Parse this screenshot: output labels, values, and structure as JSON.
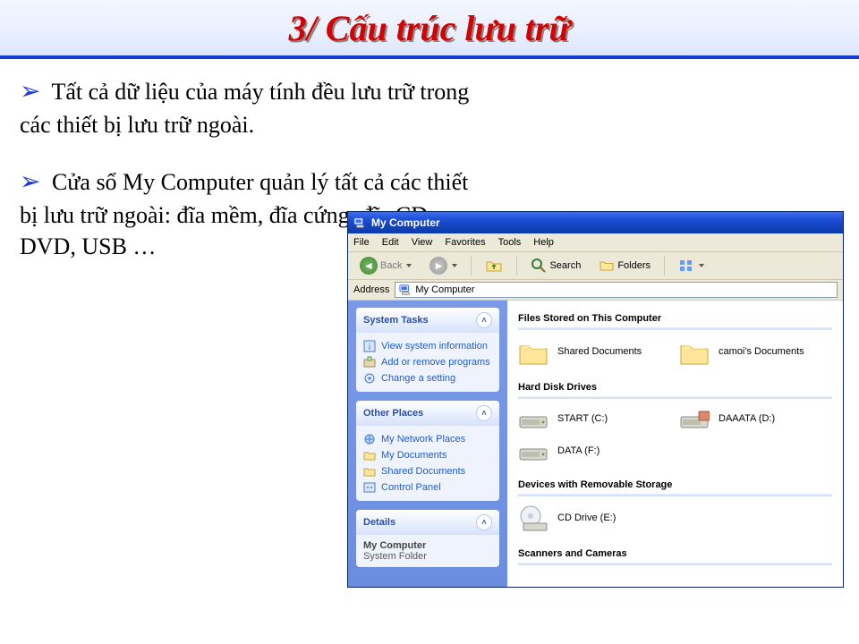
{
  "slide": {
    "title": "3/ Cấu trúc lưu trữ",
    "p1": "Tất cả dữ liệu của máy tính đều lưu trữ trong các thiết bị lưu trữ ngoài.",
    "p2": "Cửa sổ My Computer quản lý tất cả các thiết bị lưu trữ ngoài: đĩa mềm, đĩa cứng, đĩa CD, DVD, USB …"
  },
  "window": {
    "title": "My Computer",
    "menu": [
      "File",
      "Edit",
      "View",
      "Favorites",
      "Tools",
      "Help"
    ],
    "toolbar": {
      "back": "Back",
      "search": "Search",
      "folders": "Folders"
    },
    "address_label": "Address",
    "address_value": "My Computer",
    "sidebar": {
      "system_tasks": {
        "title": "System Tasks",
        "items": [
          "View system information",
          "Add or remove programs",
          "Change a setting"
        ]
      },
      "other_places": {
        "title": "Other Places",
        "items": [
          "My Network Places",
          "My Documents",
          "Shared Documents",
          "Control Panel"
        ]
      },
      "details": {
        "title": "Details",
        "name": "My Computer",
        "type": "System Folder"
      }
    },
    "main": {
      "sections": {
        "files": {
          "title": "Files Stored on This Computer",
          "items": [
            "Shared Documents",
            "camoi's Documents"
          ]
        },
        "hdd": {
          "title": "Hard Disk Drives",
          "items": [
            "START (C:)",
            "DAAATA (D:)",
            "DATA (F:)"
          ]
        },
        "removable": {
          "title": "Devices with Removable Storage",
          "items": [
            "CD Drive (E:)"
          ]
        },
        "scanners": {
          "title": "Scanners and Cameras"
        }
      }
    }
  }
}
